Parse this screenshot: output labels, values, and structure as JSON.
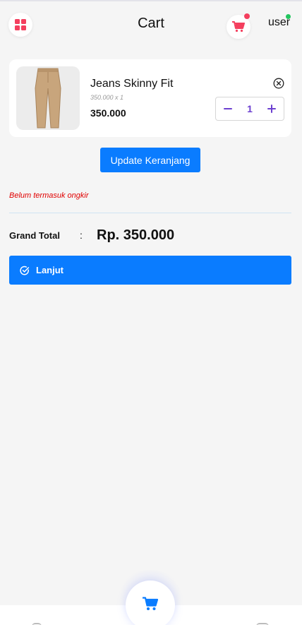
{
  "header": {
    "title": "Cart",
    "user_label": "user",
    "menu_icon": "grid-icon",
    "cart_icon": "cart-icon"
  },
  "cart": {
    "items": [
      {
        "name": "Jeans Skinny Fit",
        "price_x_qty": "350.000 x 1",
        "price": "350.000",
        "quantity": "1",
        "image": "khaki-pants"
      }
    ]
  },
  "actions": {
    "update_label": "Update Keranjang",
    "next_label": "Lanjut"
  },
  "summary": {
    "shipping_note": "Belum termasuk ongkir",
    "grand_total_label": "Grand Total",
    "separator": ":",
    "grand_total_value": "Rp. 350.000"
  },
  "colors": {
    "primary": "#0a7cff",
    "accent_icon": "#f43f5e",
    "quantity": "#6c3fd0",
    "online": "#22c55e",
    "warning_text": "#e00000"
  }
}
